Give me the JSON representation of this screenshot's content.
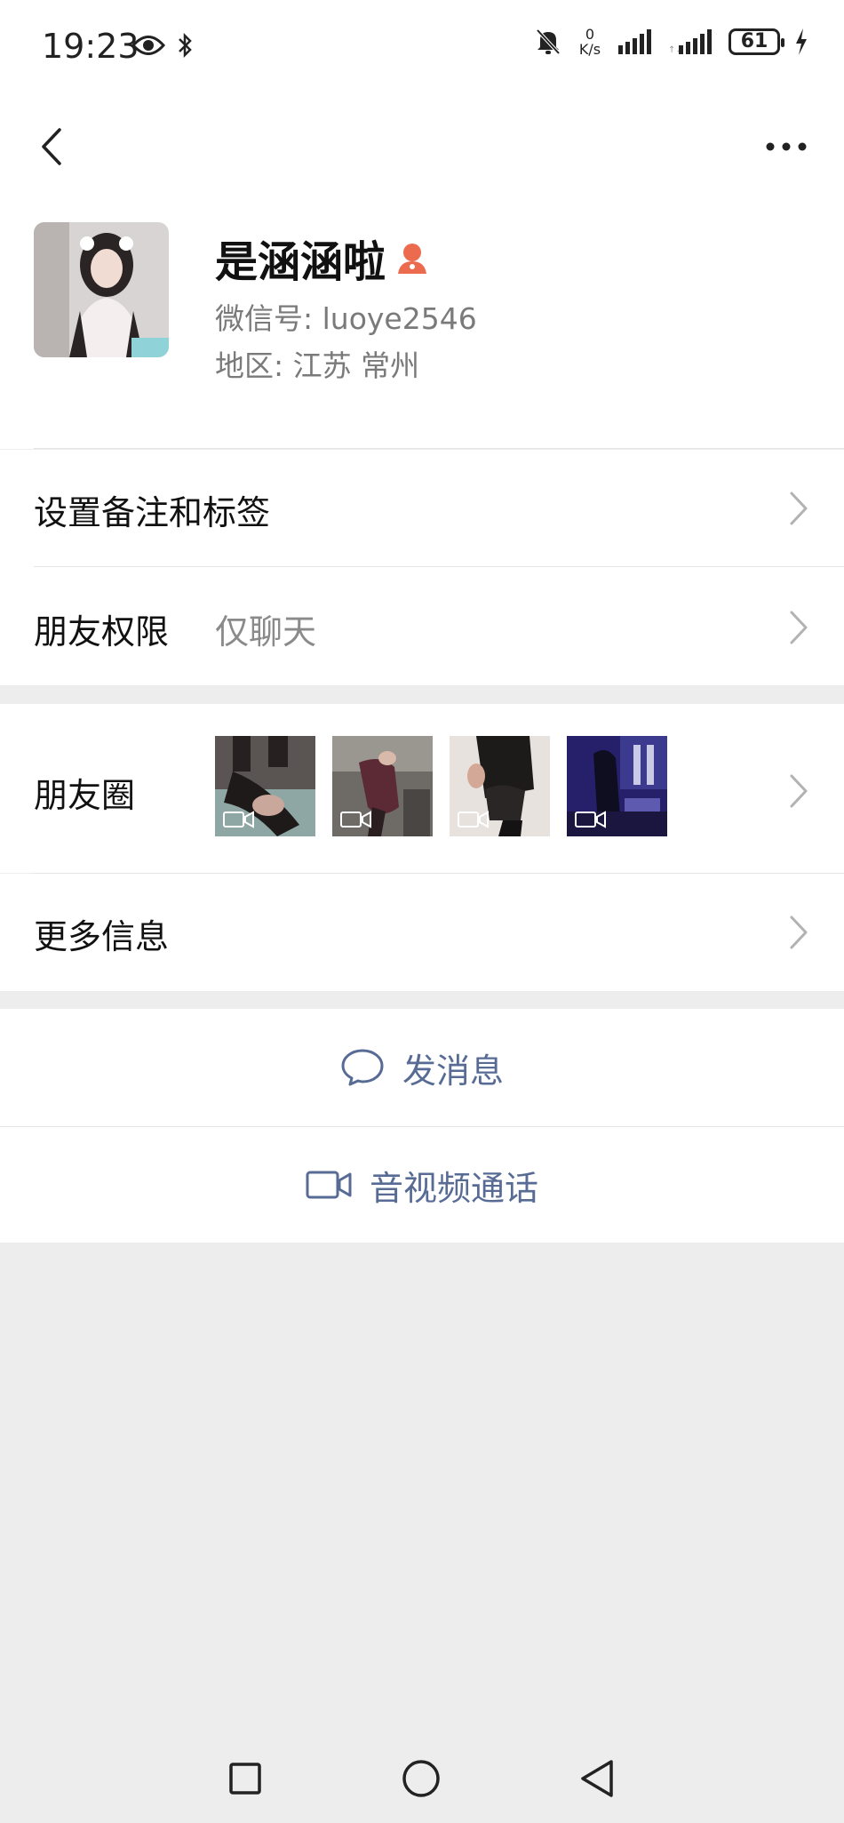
{
  "status_bar": {
    "time": "19:23",
    "net_speed_value": "0",
    "net_speed_unit": "K/s",
    "battery": "61"
  },
  "profile": {
    "name": "是涵涵啦",
    "wechat_id": "微信号: luoye2546",
    "region": "地区: 江苏 常州"
  },
  "rows": {
    "remark_tags": "设置备注和标签",
    "permission_label": "朋友权限",
    "permission_value": "仅聊天",
    "moments_label": "朋友圈",
    "more_info": "更多信息"
  },
  "actions": {
    "send_message": "发消息",
    "video_call": "音视频通话"
  },
  "colors": {
    "link_blue": "#576b95",
    "page_bg": "#ededed",
    "badge_orange": "#ec6b4f"
  }
}
